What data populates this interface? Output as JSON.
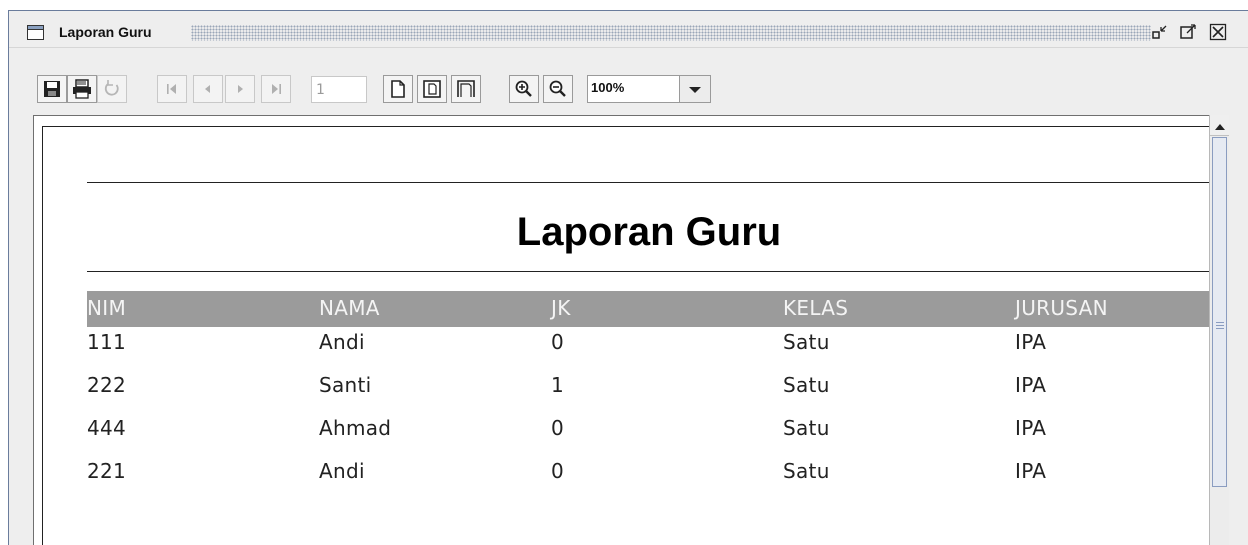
{
  "window": {
    "title": "Laporan Guru",
    "icons": [
      "window-icon",
      "minimize-icon",
      "maximize-icon",
      "close-icon"
    ]
  },
  "toolbar": {
    "page_number": "1",
    "zoom_value": "100%",
    "buttons": [
      "save-icon",
      "print-icon",
      "reload-icon",
      "first-page-icon",
      "previous-page-icon",
      "next-page-icon",
      "last-page-icon",
      "actual-size-icon",
      "fit-page-icon",
      "fit-width-icon",
      "zoom-in-icon",
      "zoom-out-icon",
      "dropdown-arrow-icon"
    ]
  },
  "report": {
    "title": "Laporan Guru",
    "columns": [
      "NIM",
      "NAMA",
      "JK",
      "KELAS",
      "JURUSAN"
    ],
    "rows": [
      [
        "111",
        "Andi",
        "0",
        "Satu",
        "IPA"
      ],
      [
        "222",
        "Santi",
        "1",
        "Satu",
        "IPA"
      ],
      [
        "444",
        "Ahmad",
        "0",
        "Satu",
        "IPA"
      ],
      [
        "221",
        "Andi",
        "0",
        "Satu",
        "IPA"
      ]
    ]
  },
  "colors": {
    "header_bg": "#9b9b9b",
    "header_text": "#f4f4f4",
    "scroll_thumb_border": "#8a9cc0"
  }
}
